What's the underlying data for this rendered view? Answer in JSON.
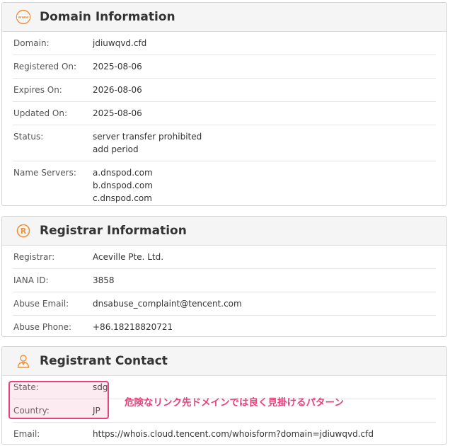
{
  "domain_info": {
    "title": "Domain Information",
    "rows": [
      {
        "label": "Domain:",
        "values": [
          "jdiuwqvd.cfd"
        ]
      },
      {
        "label": "Registered On:",
        "values": [
          "2025-08-06"
        ]
      },
      {
        "label": "Expires On:",
        "values": [
          "2026-08-06"
        ]
      },
      {
        "label": "Updated On:",
        "values": [
          "2025-08-06"
        ]
      },
      {
        "label": "Status:",
        "values": [
          "server transfer prohibited",
          "add period"
        ]
      },
      {
        "label": "Name Servers:",
        "values": [
          "a.dnspod.com",
          "b.dnspod.com",
          "c.dnspod.com"
        ]
      }
    ]
  },
  "registrar_info": {
    "title": "Registrar Information",
    "rows": [
      {
        "label": "Registrar:",
        "values": [
          "Aceville Pte. Ltd."
        ]
      },
      {
        "label": "IANA ID:",
        "values": [
          "3858"
        ]
      },
      {
        "label": "Abuse Email:",
        "values": [
          "dnsabuse_complaint@tencent.com"
        ]
      },
      {
        "label": "Abuse Phone:",
        "values": [
          "+86.18218820721"
        ]
      }
    ]
  },
  "registrant_contact": {
    "title": "Registrant Contact",
    "rows": [
      {
        "label": "State:",
        "values": [
          "sdg"
        ]
      },
      {
        "label": "Country:",
        "values": [
          "JP"
        ]
      },
      {
        "label": "Email:",
        "values": [
          "https://whois.cloud.tencent.com/whoisform?domain=jdiuwqvd.cfd"
        ]
      }
    ]
  },
  "annotation": {
    "text": "危険なリンク先ドメインでは良く見掛けるパターン",
    "color": "#e8417a"
  },
  "icons": {
    "domain": "www-globe-icon",
    "registrar": "registered-mark-icon",
    "registrant": "person-contact-icon"
  },
  "accent_color": "#f0913a"
}
